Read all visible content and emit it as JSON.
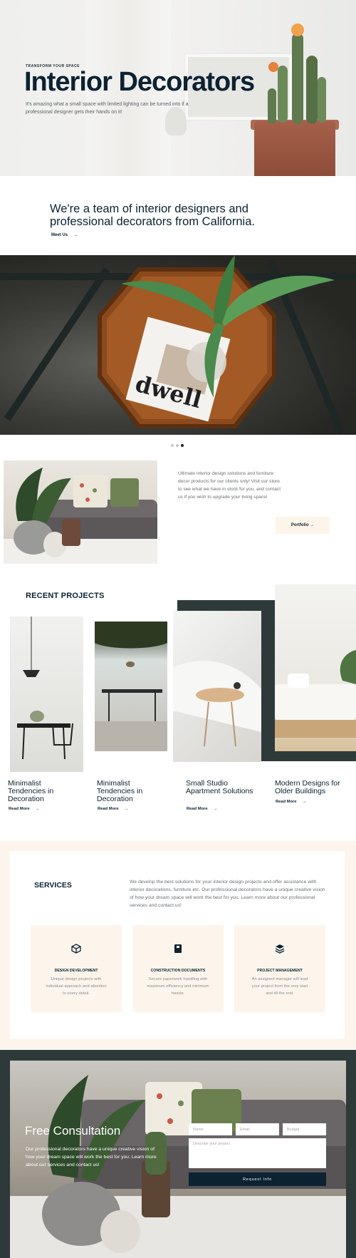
{
  "hero": {
    "eyebrow": "TRANSFORM YOUR SPACE",
    "title": "Interior Decorators",
    "description": "It's amazing what a small space with limited lighting can be turned into if a professional designer gets their hands on it!"
  },
  "team": {
    "heading": "We're a team of interior designers and professional decorators from California.",
    "meet_label": "Meet Us",
    "arrow": "→"
  },
  "carousel": {
    "active_index": 2,
    "count": 3
  },
  "store": {
    "text": "Ultimate interior design solutions and furniture decor products for our clients only! Visit our store to see what we have in stock for you, and contact us if you wish to upgrade your living space!",
    "portfolio_label": "Portfolio →"
  },
  "recent": {
    "title": "RECENT PROJECTS",
    "projects": [
      {
        "title": "Minimalist Tendencies in Decoration",
        "read": "Read More"
      },
      {
        "title": "Minimalist Tendencies in Decoration",
        "read": "Read More"
      },
      {
        "title": "Small Studio Apartment Solutions",
        "read": "Read More"
      },
      {
        "title": "Modern Designs for Older Buildings",
        "read": "Read More"
      }
    ]
  },
  "services": {
    "title": "SERVICES",
    "description": "We develop the best solutions for your interior design projects and offer assistance with interior decorations, furniture etc. Our professional decorators have a unique creative vision of how your dream space will work the best for you. Learn more about our professional services and contact us!",
    "items": [
      {
        "icon": "cube-icon",
        "name": "DESIGN DEVELOPMENT",
        "text": "Unique design projects with individual approach and attention to every detail."
      },
      {
        "icon": "book-icon",
        "name": "CONSTRUCTION DOCUMENTS",
        "text": "Secure paperwork handling with maximum efficiency and minimum hassle."
      },
      {
        "icon": "layers-icon",
        "name": "PROJECT MANAGEMENT",
        "text": "An assigned manager will lead your project from the very start and till the end."
      }
    ]
  },
  "consultation": {
    "title": "Free Consultation",
    "description": "Our professional decorators have a unique creative vision of how your dream space will work the best for you. Learn more about our services and contact us!",
    "name_placeholder": "Name",
    "email_placeholder": "Email",
    "budget_placeholder": "Budget",
    "project_placeholder": "Describe your project",
    "button_label": "Request Info"
  },
  "colors": {
    "navy": "#0b2233",
    "dark_teal": "#2d3a39",
    "cream": "#fdf5ec",
    "terracotta": "#a6604a"
  }
}
